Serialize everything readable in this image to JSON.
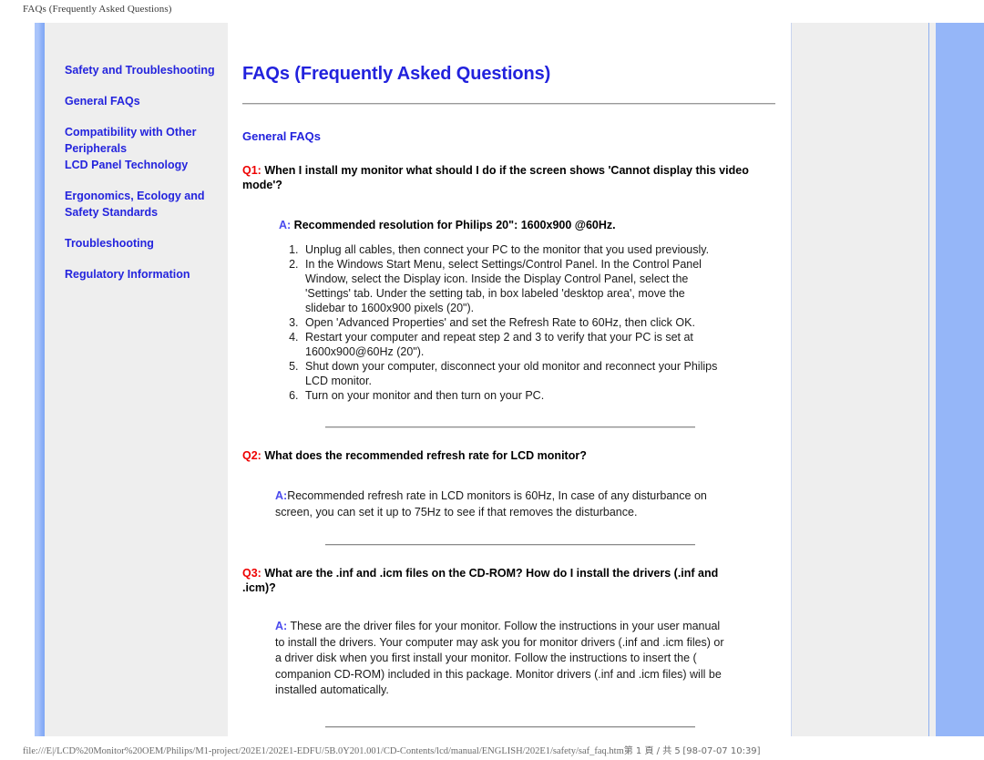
{
  "print": {
    "header": "FAQs (Frequently Asked Questions)",
    "footer_path": "file:///E|/LCD%20Monitor%20OEM/Philips/M1-project/202E1/202E1-EDFU/5B.0Y201.001/CD-Contents/lcd/manual/ENGLISH/202E1/safety/saf_faq.htm",
    "footer_page": "第 1 頁 / 共 5",
    "footer_timestamp": "[98-07-07 10:39]"
  },
  "colors": {
    "link_blue": "#2424dd",
    "title_blue": "#2222dd",
    "q_red": "#ee0000",
    "a_blue": "#4a4aee",
    "panel_gray": "#eeeeee",
    "stripe_blue": "#95b6f8"
  },
  "sidebar": {
    "items": [
      {
        "label": "Safety and Troubleshooting"
      },
      {
        "label": "General FAQs"
      },
      {
        "label": "Compatibility with Other Peripherals"
      },
      {
        "label": "LCD Panel Technology"
      },
      {
        "label": "Ergonomics, Ecology and Safety Standards"
      },
      {
        "label": "Troubleshooting"
      },
      {
        "label": "Regulatory Information"
      }
    ]
  },
  "main": {
    "title": "FAQs (Frequently Asked Questions)",
    "section_title": "General FAQs",
    "faqs": [
      {
        "q_label": "Q1:",
        "q_text": " When I install my monitor what should I do if the screen shows 'Cannot display this video mode'?",
        "a_label": "A:",
        "a_text": " Recommended resolution for Philips 20\": 1600x900 @60Hz.",
        "steps": [
          "Unplug all cables, then connect your PC to the monitor that you used previously.",
          "In the Windows Start Menu, select Settings/Control Panel. In the Control Panel Window, select the Display icon. Inside the Display Control Panel, select the 'Settings' tab. Under the setting tab, in box labeled 'desktop area', move the slidebar to 1600x900 pixels (20\").",
          "Open 'Advanced Properties' and set the Refresh Rate to 60Hz, then click OK.",
          "Restart your computer and repeat step 2 and 3 to verify that your PC is set at 1600x900@60Hz (20\").",
          "Shut down your computer, disconnect your old monitor and reconnect your Philips LCD monitor.",
          "Turn on your monitor and then turn on your PC."
        ]
      },
      {
        "q_label": "Q2:",
        "q_text": " What does the recommended refresh rate for LCD monitor?",
        "a_label": "A:",
        "a_text": "Recommended refresh rate in LCD monitors is 60Hz, In case of any disturbance on screen, you can set it up to 75Hz to see if that removes the disturbance."
      },
      {
        "q_label": "Q3:",
        "q_text": " What are the .inf and .icm files on the CD-ROM? How do I install the drivers (.inf and .icm)?",
        "a_label": "A:",
        "a_text": " These are the driver files for your monitor. Follow the instructions in your user manual to install the drivers. Your computer may ask you for monitor drivers (.inf and .icm files) or a driver disk when you first install your monitor. Follow the instructions to insert the ( companion CD-ROM) included in this package. Monitor drivers (.inf and .icm files) will be installed automatically."
      }
    ]
  }
}
